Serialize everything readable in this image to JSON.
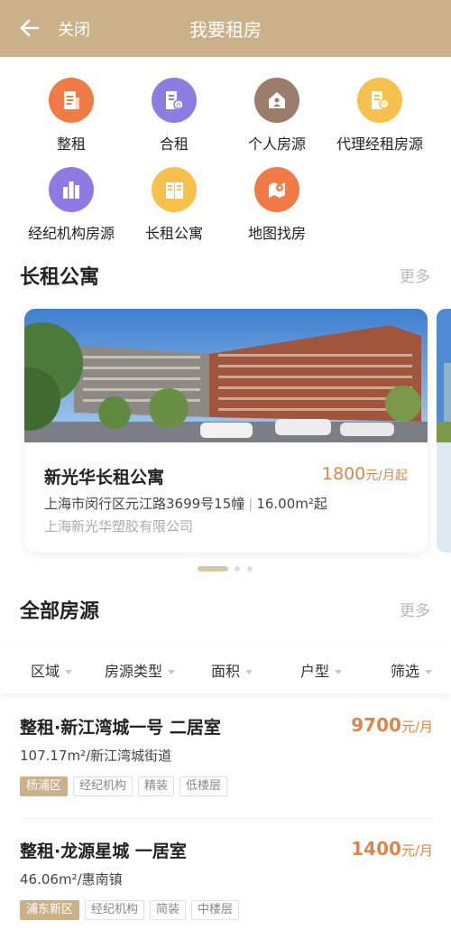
{
  "header": {
    "close_label": "关闭",
    "title": "我要租房"
  },
  "categories": [
    {
      "label": "整租",
      "icon": "building-doc-icon",
      "color": "#f07b47"
    },
    {
      "label": "合租",
      "icon": "shared-building-icon",
      "color": "#8a7fe0"
    },
    {
      "label": "个人房源",
      "icon": "house-icon",
      "color": "#9a7d6b"
    },
    {
      "label": "代理经租房源",
      "icon": "agent-building-icon",
      "color": "#f6c14c"
    },
    {
      "label": "经纪机构房源",
      "icon": "agency-building-icon",
      "color": "#8f7ae3"
    },
    {
      "label": "长租公寓",
      "icon": "apartment-icon",
      "color": "#f6c14c"
    },
    {
      "label": "地图找房",
      "icon": "map-pin-icon",
      "color": "#f07b47"
    }
  ],
  "apartments_section": {
    "title": "长租公寓",
    "more": "更多"
  },
  "apartment_card": {
    "name": "新光华长租公寓",
    "price": "1800",
    "price_unit": "元/月起",
    "address": "上海市闵行区元江路3699号15幢",
    "area": "16.00m²起",
    "company": "上海新光华塑胶有限公司"
  },
  "all_section": {
    "title": "全部房源",
    "more": "更多"
  },
  "filters": [
    "区域",
    "房源类型",
    "面积",
    "户型",
    "筛选"
  ],
  "listings": [
    {
      "title": "整租·新江湾城一号 二居室",
      "price": "9700",
      "unit": "元/月",
      "detail": "107.17m²/新江湾城街道",
      "tags": [
        "杨浦区",
        "经纪机构",
        "精装",
        "低楼层"
      ]
    },
    {
      "title": "整租·龙源星城 一居室",
      "price": "1400",
      "unit": "元/月",
      "detail": "46.06m²/惠南镇",
      "tags": [
        "浦东新区",
        "经纪机构",
        "简装",
        "中楼层"
      ]
    }
  ],
  "colors": {
    "brand": "#cbb189",
    "price": "#d9874a"
  }
}
